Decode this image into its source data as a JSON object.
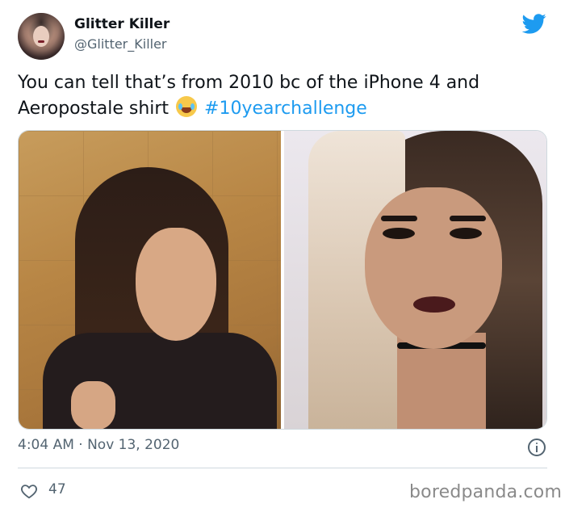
{
  "author": {
    "display_name": "Glitter Killer",
    "handle": "@Glitter_Killer",
    "avatar_icon": "avatar"
  },
  "brand_icon": "twitter-bird-icon",
  "tweet": {
    "text_before_emoji": "You can tell that’s from 2010 bc of the iPhone 4 and Aeropostale shirt",
    "emoji_icon": "face-with-tears-of-joy-icon",
    "hashtag": "#10yearchallenge"
  },
  "media": {
    "images": [
      {
        "name": "photo-2010"
      },
      {
        "name": "photo-2020"
      }
    ]
  },
  "meta": {
    "timestamp": "4:04 AM · Nov 13, 2020",
    "info_icon": "info-icon"
  },
  "engagement": {
    "likes": "47",
    "like_icon": "heart-icon"
  },
  "watermark": "boredpanda.com",
  "colors": {
    "accent": "#1d9bf0",
    "text_primary": "#0f1419",
    "text_secondary": "#536471",
    "border": "#cfd9de"
  }
}
